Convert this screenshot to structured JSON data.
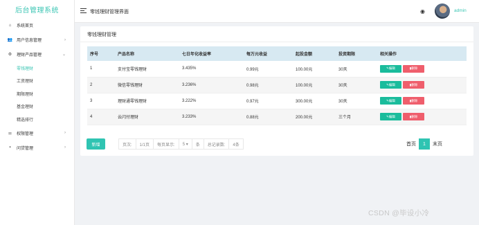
{
  "app": {
    "title": "后台管理系统"
  },
  "header": {
    "title": "零钱理财管理界面",
    "user": "admin"
  },
  "sidebar": {
    "items": [
      {
        "label": "系统首页",
        "icon": "home-icon",
        "glyph": "⌂"
      },
      {
        "label": "用户信息管理",
        "icon": "users-icon",
        "glyph": "👥",
        "arrow": "›"
      },
      {
        "label": "理财产品管理",
        "icon": "settings-icon",
        "glyph": "⚙",
        "arrow": "⌄"
      }
    ],
    "submenu": [
      "零钱理财",
      "工资理财",
      "期限理财",
      "基金理财",
      "精选排行"
    ],
    "items_after": [
      {
        "label": "权限管理",
        "icon": "sliders-icon",
        "glyph": "⚌",
        "arrow": "›"
      },
      {
        "label": "问贷管理",
        "icon": "message-icon",
        "glyph": "▪",
        "arrow": "›"
      }
    ]
  },
  "card": {
    "title": "零钱理财管理"
  },
  "table": {
    "headers": [
      "序号",
      "产品名称",
      "七日年化收益率",
      "每万元收益",
      "起投金额",
      "投资期限",
      "相关操作"
    ],
    "rows": [
      [
        "1",
        "支付宝零钱理财",
        "3.435%",
        "0.99元",
        "100.00元",
        "30天"
      ],
      [
        "2",
        "微信零钱理财",
        "3.236%",
        "0.98元",
        "100.00元",
        "30天"
      ],
      [
        "3",
        "理财通零钱理财",
        "3.222%",
        "0.97元",
        "300.00元",
        "30天"
      ],
      [
        "4",
        "云闪付理财",
        "3.233%",
        "0.88元",
        "200.00元",
        "三个月"
      ]
    ],
    "edit_label": "编辑",
    "delete_label": "删除"
  },
  "footer": {
    "add_label": "新增",
    "pager": {
      "page_label": "页次:",
      "page_value": "1/1页",
      "per_page_label": "每页显示:",
      "per_page_value": "5 ▾",
      "per_page_unit": "条",
      "total_label": "总记录数:",
      "total_value": "4条"
    },
    "pagination": {
      "first": "首页",
      "current": "1",
      "last": "末页"
    }
  },
  "watermark": "CSDN @毕设小冷",
  "colors": {
    "accent": "#2fc4b2",
    "header_bg": "#d7e9f2",
    "edit": "#1abc9c",
    "delete": "#ef5e6c"
  }
}
